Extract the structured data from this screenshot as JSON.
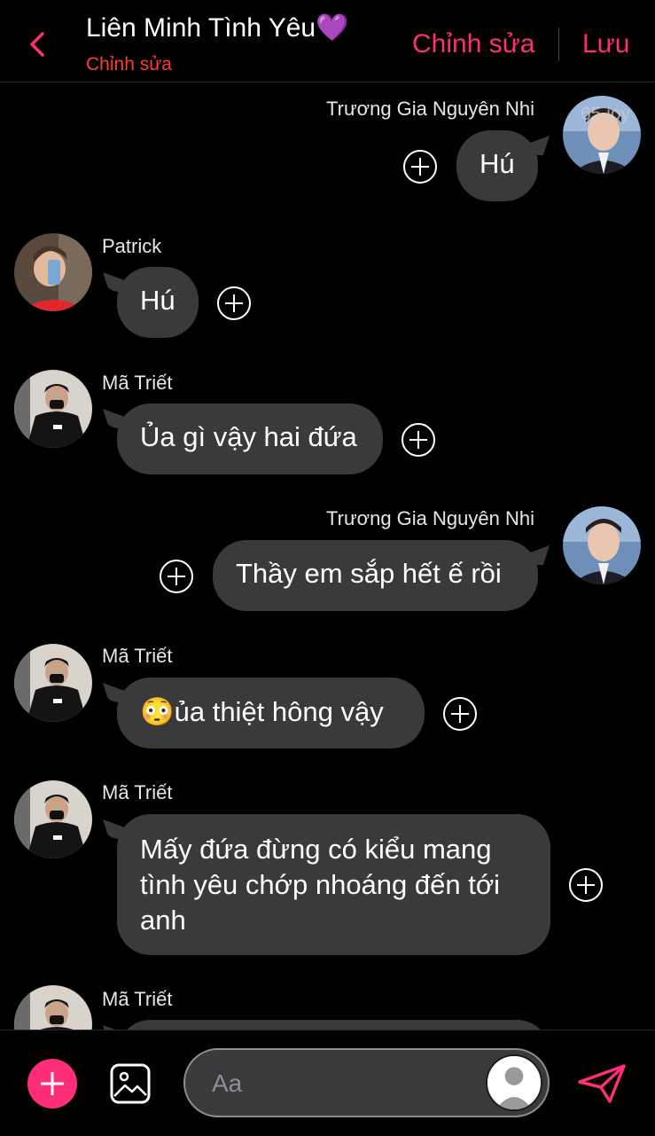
{
  "header": {
    "title": "Liên Minh Tình Yêu💜",
    "subtitle": "Chỉnh sửa",
    "edit_label": "Chỉnh sửa",
    "save_label": "Lưu",
    "accent": "#ff2d7a"
  },
  "watermark": "65 joy",
  "messages": [
    {
      "sender": "Trương Gia Nguyên Nhi",
      "side": "right",
      "text": "Hú"
    },
    {
      "sender": "Patrick",
      "side": "left",
      "text": "Hú"
    },
    {
      "sender": "Mã Triết",
      "side": "left",
      "text": "Ủa gì vậy hai đứa"
    },
    {
      "sender": "Trương Gia Nguyên Nhi",
      "side": "right",
      "text": "Thầy em sắp hết ế rồi"
    },
    {
      "sender": "Mã Triết",
      "side": "left",
      "emoji": "😳",
      "text": "ủa thiệt hông vậy"
    },
    {
      "sender": "Mã Triết",
      "side": "left",
      "lines": [
        "Mấy đứa đừng có kiểu mang",
        "tình yêu chớp nhoáng đến tới",
        "anh"
      ]
    },
    {
      "sender": "Mã Triết",
      "side": "left",
      "text": ""
    }
  ],
  "composer": {
    "placeholder": "Aa",
    "add_icon": "plus-icon",
    "image_icon": "image-icon",
    "send_icon": "send-icon"
  }
}
